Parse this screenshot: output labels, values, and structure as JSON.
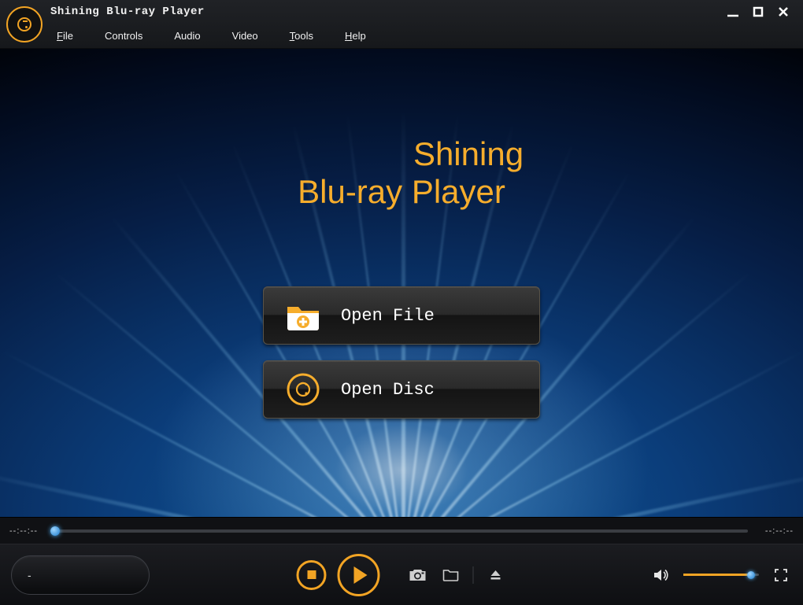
{
  "app": {
    "title": "Shining Blu-ray Player"
  },
  "menu": {
    "file": "File",
    "controls": "Controls",
    "audio": "Audio",
    "video": "Video",
    "tools": "Tools",
    "help": "Help"
  },
  "hero": {
    "line1": "Shining",
    "line2": "Blu-ray Player"
  },
  "buttons": {
    "open_file": "Open File",
    "open_disc": "Open Disc"
  },
  "playback": {
    "elapsed": "--:--:--",
    "remaining": "--:--:--",
    "progress_percent": 0,
    "now_playing": "-"
  },
  "volume": {
    "percent": 90
  },
  "colors": {
    "accent": "#f2a424"
  }
}
